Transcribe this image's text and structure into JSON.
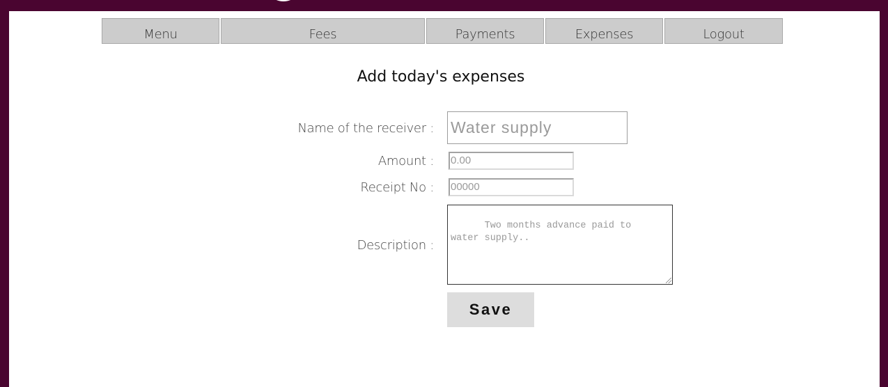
{
  "nav": {
    "items": [
      {
        "label": "Menu"
      },
      {
        "label": "Fees"
      },
      {
        "label": "Payments"
      },
      {
        "label": "Expenses"
      },
      {
        "label": "Logout"
      }
    ]
  },
  "form": {
    "title": "Add today's expenses",
    "receiver_label": "Name of the receiver :",
    "receiver_placeholder": "Water supply",
    "amount_label": "Amount :",
    "amount_placeholder": "0.00",
    "receipt_label": "Receipt No :",
    "receipt_placeholder": "00000",
    "description_label": "Description :",
    "description_placeholder": "Two months advance paid to\nwater supply..",
    "save_label": "Save"
  },
  "colors": {
    "background": "#4a0530",
    "panel": "#ffffff",
    "nav_button": "#cccccc",
    "save_button": "#dddddd",
    "placeholder_text": "#9a9a9a"
  }
}
